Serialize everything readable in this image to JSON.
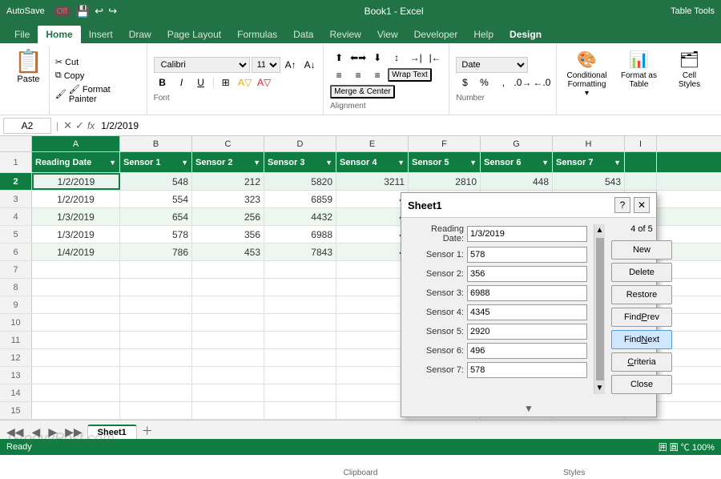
{
  "titlebar": {
    "autosave": "AutoSave",
    "autosave_state": "Off",
    "title": "Book1 - Excel",
    "table_tools": "Table Tools"
  },
  "ribbon_tabs": {
    "tabs": [
      "File",
      "Home",
      "Insert",
      "Draw",
      "Page Layout",
      "Formulas",
      "Data",
      "Review",
      "View",
      "Developer",
      "Help",
      "Design"
    ],
    "active_tab": "Home",
    "design_tab": "Design"
  },
  "clipboard": {
    "paste": "Paste",
    "cut": "✂ Cut",
    "copy": "📋 Copy",
    "format_painter": "🖌 Format Painter",
    "label": "Clipboard"
  },
  "font": {
    "face": "Calibri",
    "size": "11",
    "label": "Font"
  },
  "alignment": {
    "label": "Alignment",
    "wrap_text": "Wrap Text",
    "merge_center": "Merge & Center"
  },
  "number": {
    "format": "Date",
    "label": "Number"
  },
  "styles": {
    "conditional_formatting": "Conditional Formatting",
    "format_as_table": "Format as Table",
    "cell_styles": "Cell Styles",
    "label": "Styles"
  },
  "formula_bar": {
    "cell_ref": "A2",
    "cancel": "✕",
    "confirm": "✓",
    "fx": "fx",
    "value": "1/2/2019"
  },
  "columns": {
    "letters": [
      "A",
      "B",
      "C",
      "D",
      "E",
      "F",
      "G",
      "H"
    ],
    "headers": [
      "Reading Date▼",
      "Sensor 1▼",
      "Sensor 2▼",
      "Sensor 3▼",
      "Sensor 4▼",
      "Sensor 5▼",
      "Sensor 6▼",
      "Sensor 7▼"
    ]
  },
  "rows": [
    {
      "num": "1",
      "is_header": true,
      "cells": [
        "Reading Date",
        "Sensor 1",
        "Sensor 2",
        "Sensor 3",
        "Sensor 4",
        "Sensor 5",
        "Sensor 6",
        "Sensor 7"
      ]
    },
    {
      "num": "2",
      "is_selected": true,
      "cells": [
        "1/2/2019",
        "548",
        "212",
        "5820",
        "3211",
        "2810",
        "448",
        "543"
      ]
    },
    {
      "num": "3",
      "cells": [
        "1/2/2019",
        "554",
        "323",
        "6859",
        "4",
        "",
        "",
        ""
      ]
    },
    {
      "num": "4",
      "cells": [
        "1/3/2019",
        "654",
        "256",
        "4432",
        "4",
        "",
        "",
        ""
      ]
    },
    {
      "num": "5",
      "cells": [
        "1/3/2019",
        "578",
        "356",
        "6988",
        "4",
        "",
        "",
        ""
      ]
    },
    {
      "num": "6",
      "cells": [
        "1/4/2019",
        "786",
        "453",
        "7843",
        "4",
        "",
        "",
        ""
      ]
    },
    {
      "num": "7",
      "cells": [
        "",
        "",
        "",
        "",
        "",
        "",
        "",
        ""
      ]
    },
    {
      "num": "8",
      "cells": [
        "",
        "",
        "",
        "",
        "",
        "",
        "",
        ""
      ]
    },
    {
      "num": "9",
      "cells": [
        "",
        "",
        "",
        "",
        "",
        "",
        "",
        ""
      ]
    },
    {
      "num": "10",
      "cells": [
        "",
        "",
        "",
        "",
        "",
        "",
        "",
        ""
      ]
    },
    {
      "num": "11",
      "cells": [
        "",
        "",
        "",
        "",
        "",
        "",
        "",
        ""
      ]
    },
    {
      "num": "12",
      "cells": [
        "",
        "",
        "",
        "",
        "",
        "",
        "",
        ""
      ]
    },
    {
      "num": "13",
      "cells": [
        "",
        "",
        "",
        "",
        "",
        "",
        "",
        ""
      ]
    },
    {
      "num": "14",
      "cells": [
        "",
        "",
        "",
        "",
        "",
        "",
        "",
        ""
      ]
    },
    {
      "num": "15",
      "cells": [
        "",
        "",
        "",
        "",
        "",
        "",
        "",
        ""
      ]
    }
  ],
  "dialog": {
    "title": "Sheet1",
    "record_info": "4 of 5",
    "fields": [
      {
        "label": "Reading Date:",
        "value": "1/3/2019"
      },
      {
        "label": "Sensor 1:",
        "value": "578"
      },
      {
        "label": "Sensor 2:",
        "value": "356"
      },
      {
        "label": "Sensor 3:",
        "value": "6988"
      },
      {
        "label": "Sensor 4:",
        "value": "4345"
      },
      {
        "label": "Sensor 5:",
        "value": "2920"
      },
      {
        "label": "Sensor 6:",
        "value": "496"
      },
      {
        "label": "Sensor 7:",
        "value": "578"
      }
    ],
    "buttons": [
      "New",
      "Delete",
      "Restore",
      "Find Prev",
      "Find Next",
      "Criteria",
      "Close"
    ]
  },
  "sheet_tabs": [
    "Sheet1"
  ],
  "status": {
    "left": "Ready",
    "right": "囲 圓 ℃ 100%"
  },
  "watermark": "GroovyPost.com"
}
